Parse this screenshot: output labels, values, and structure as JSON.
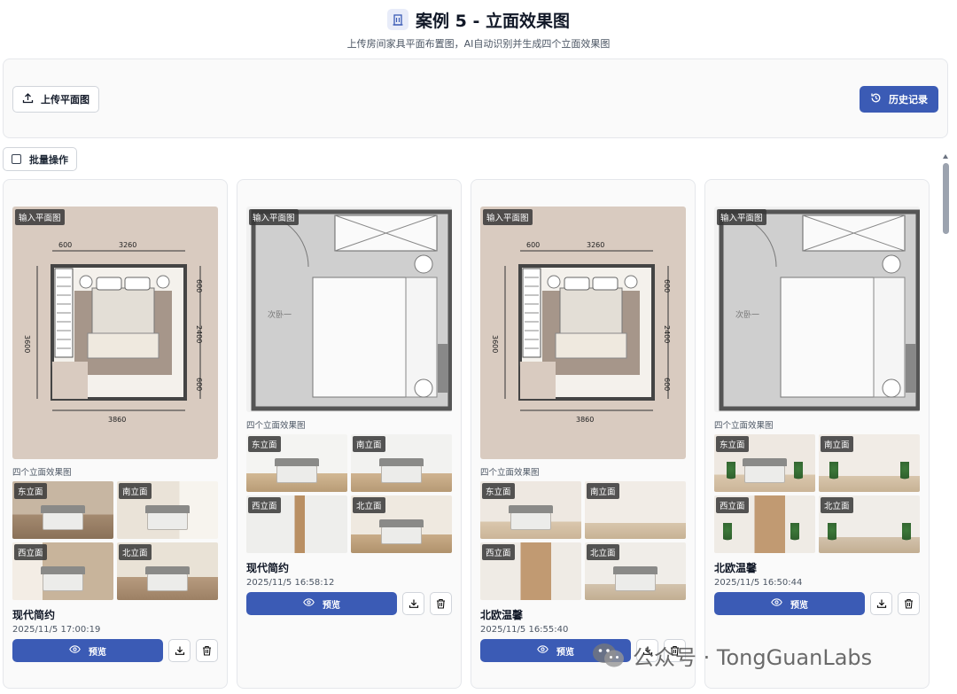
{
  "header": {
    "title": "案例 5 - 立面效果图",
    "subtitle": "上传房间家具平面布置图，AI自动识别并生成四个立面效果图"
  },
  "toolbar": {
    "upload_label": "上传平面图",
    "history_label": "历史记录",
    "batch_label": "批量操作"
  },
  "labels": {
    "input_tag": "输入平面图",
    "views_section": "四个立面效果图",
    "preview": "预览"
  },
  "floorplan_a": {
    "dims_top_left": "600",
    "dims_top": "3260",
    "dims_left": "3600",
    "dims_right_1": "600",
    "dims_right_2": "2400",
    "dims_right_3": "600",
    "dims_bottom": "3860"
  },
  "floorplan_b": {
    "room_label": "次卧一"
  },
  "cards": [
    {
      "style": "现代简约",
      "date": "2025/11/5 17:00:19",
      "views": [
        "东立面",
        "南立面",
        "西立面",
        "北立面"
      ]
    },
    {
      "style": "现代简约",
      "date": "2025/11/5 16:58:12",
      "views": [
        "东立面",
        "南立面",
        "西立面",
        "北立面"
      ]
    },
    {
      "style": "北欧温馨",
      "date": "2025/11/5 16:55:40",
      "views": [
        "东立面",
        "南立面",
        "西立面",
        "北立面"
      ]
    },
    {
      "style": "北欧温馨",
      "date": "2025/11/5 16:50:44",
      "views": [
        "东立面",
        "南立面",
        "西立面",
        "北立面"
      ]
    }
  ],
  "watermark": {
    "text": "公众号 · TongGuanLabs"
  },
  "colors": {
    "primary": "#3b5bb5",
    "floorplan_bg": "#d9cbc0"
  }
}
